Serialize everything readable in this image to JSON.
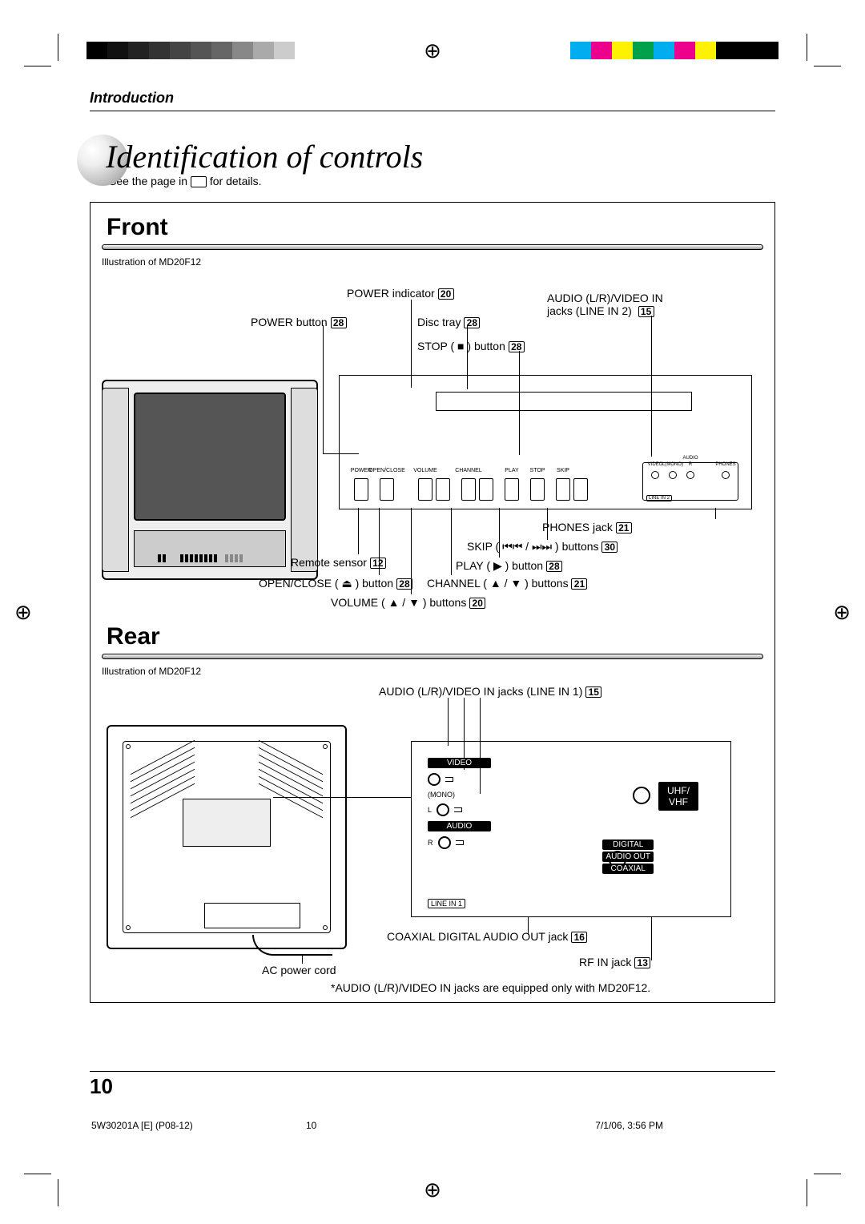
{
  "running_head": "Introduction",
  "page_title": "Identification of controls",
  "see_prefix": "See the page in ",
  "see_suffix": " for details.",
  "section_front": "Front",
  "section_rear": "Rear",
  "illus_note": "Illustration of MD20F12",
  "front": {
    "power_indicator": "POWER indicator",
    "power_indicator_pg": "20",
    "audio_video_in": "AUDIO L/R)/VIDEO IN",
    "audio_video_in_fixed": "AUDIO (L/R)/VIDEO IN",
    "jacks_line2": "jacks (LINE IN 2)",
    "jacks_line2_pg": "15",
    "power_button": "POWER button",
    "power_button_pg": "28",
    "disc_tray": "Disc tray",
    "disc_tray_pg": "28",
    "stop_button": "STOP ( ■ ) button",
    "stop_button_pg": "28",
    "phones": "PHONES jack",
    "phones_pg": "21",
    "skip": "SKIP ( ⏮⏮ / ⏭⏭ ) buttons",
    "skip_pg": "30",
    "remote": "Remote sensor",
    "remote_pg": "12",
    "play": "PLAY ( ▶ ) button",
    "play_pg": "28",
    "openclose": "OPEN/CLOSE ( ⏏ ) button",
    "openclose_pg": "28",
    "channel": "CHANNEL ( ▲ / ▼ ) buttons",
    "channel_pg": "21",
    "volume": "VOLUME ( ▲ / ▼ ) buttons",
    "volume_pg": "20",
    "panel_labels": {
      "power": "POWER",
      "openclose": "OPEN/CLOSE",
      "volume": "VOLUME",
      "channel": "CHANNEL",
      "play": "PLAY",
      "stop": "STOP",
      "skip": "SKIP",
      "video": "VIDEO",
      "audio": "AUDIO",
      "lmono": "L(MONO)",
      "r": "R",
      "phones": "PHONES",
      "linein2": "LINE IN 2"
    }
  },
  "rear": {
    "audio_video_in": "AUDIO (L/R)/VIDEO IN jacks (LINE IN 1)",
    "audio_video_in_pg": "15",
    "video": "VIDEO",
    "mono": "(MONO)",
    "l": "L",
    "audio": "AUDIO",
    "r": "R",
    "uhf": "UHF/",
    "vhf": "VHF",
    "digital": "DIGITAL",
    "audio_out": "AUDIO OUT",
    "coaxial": "COAXIAL",
    "line_in_1": "LINE IN 1",
    "coax_callout": "COAXIAL DIGITAL AUDIO OUT jack",
    "coax_pg": "16",
    "rf": "RF IN jack",
    "rf_pg": "13",
    "ac": "AC power cord",
    "footnote": "*AUDIO (L/R)/VIDEO IN jacks are equipped only with MD20F12."
  },
  "page_number": "10",
  "footer": {
    "left": "5W30201A [E] (P08-12)",
    "mid": "10",
    "right": "7/1/06, 3:56 PM"
  },
  "color_swatches": [
    "#000",
    "#111",
    "#222",
    "#333",
    "#444",
    "#555",
    "#666",
    "#888",
    "#aaa",
    "#ccc"
  ],
  "cmyk_swatches": [
    "#00aeef",
    "#ec008c",
    "#fff200",
    "#00a14b",
    "#00aeef",
    "#ec008c",
    "#fff200",
    "#000",
    "#000",
    "#000"
  ]
}
